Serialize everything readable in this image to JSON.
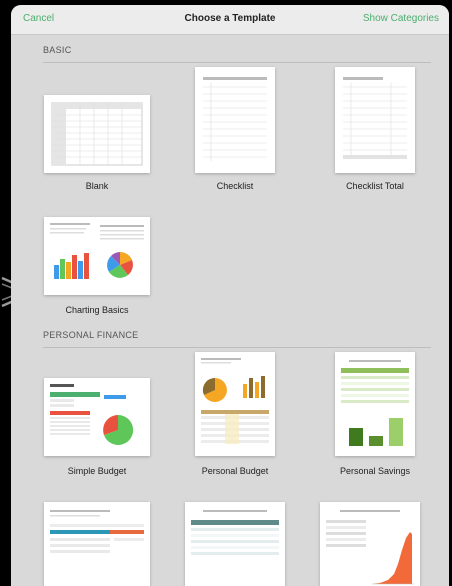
{
  "nav": {
    "cancel": "Cancel",
    "title": "Choose a Template",
    "show_categories": "Show Categories"
  },
  "sections": {
    "basic": "BASIC",
    "personal_finance": "PERSONAL FINANCE"
  },
  "templates": [
    {
      "label": "Blank"
    },
    {
      "label": "Checklist"
    },
    {
      "label": "Checklist Total"
    },
    {
      "label": "Charting Basics"
    },
    {
      "label": "Simple Budget"
    },
    {
      "label": "Personal Budget"
    },
    {
      "label": "Personal Savings"
    }
  ],
  "colors": {
    "accent": "#4caf6e",
    "sheet": "#d9d9d9",
    "nav": "#ececec"
  }
}
